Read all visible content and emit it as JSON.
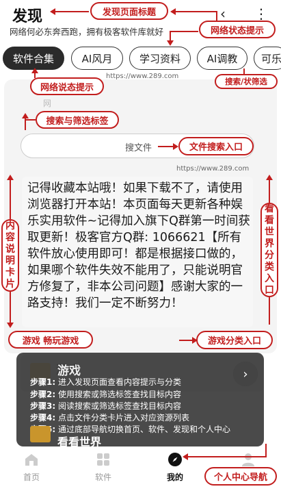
{
  "header": {
    "title": "发现",
    "subtitle": "网络何必东奔西跑，拥有极客软件库就好",
    "back_icon": "‹",
    "more_icon": "⋮"
  },
  "tabs": [
    {
      "label": "软件合集",
      "active": true
    },
    {
      "label": "AI风月",
      "active": false
    },
    {
      "label": "学习资料",
      "active": false
    },
    {
      "label": "AI调教",
      "active": false
    },
    {
      "label": "可乐",
      "active": false
    }
  ],
  "watermark": "https://www.289.com",
  "faint_label": "网",
  "search": {
    "placeholder": "搜文件"
  },
  "notice": {
    "text": "记得收藏本站哦！如果下载不了，请使用浏览器打开本站！本页面每天更新各种娱乐实用软件~记得加入旗下Q群第一时间获取更新！极客官方Q群: 1066621【所有软件放心使用即可！都是根据接口做的，如果哪个软件失效不能用了，只能说明官方修复了，非本公司问题】感谢大家的一路支持！我们一定不断努力！"
  },
  "game_card": {
    "title": "游戏",
    "chevron": "›"
  },
  "game_card_2": {
    "title": "看看世界"
  },
  "steps": [
    {
      "label": "步骤1:",
      "text": "进入发现页面查看内容提示与分类"
    },
    {
      "label": "步骤2:",
      "text": "使用搜索或筛选标签查找目标内容"
    },
    {
      "label": "步骤3:",
      "text": "阅读搜索或筛选标签查找目标内容"
    },
    {
      "label": "步骤4:",
      "text": "点击文件分类卡片进入对应资源列表"
    },
    {
      "label": "步骤5:",
      "text": "通过底部导航切换首页、软件、发现和个人中心"
    }
  ],
  "bottom_nav": [
    {
      "label": "首页",
      "icon": "home-icon",
      "active": false
    },
    {
      "label": "软件",
      "icon": "grid-icon",
      "active": false
    },
    {
      "label": "我的",
      "icon": "compass-icon",
      "active": true
    }
  ],
  "annotations": {
    "page_title": "发现页面标题",
    "network_status": "网络状态提示",
    "network_hint": "网络说态提示",
    "search_filter": "搜索/状筛选",
    "search_filter_tags": "搜索与筛选标签",
    "file_search": "文件搜索入口",
    "content_card": "内容说明卡片",
    "world_category": "看看世界分类入口",
    "games": "游戏   畅玩游戏",
    "game_category": "游戏分类入口",
    "profile_nav": "个人中心导航"
  },
  "colors": {
    "annotation": "#c21d1d",
    "active_tab": "#2b2b2b"
  }
}
